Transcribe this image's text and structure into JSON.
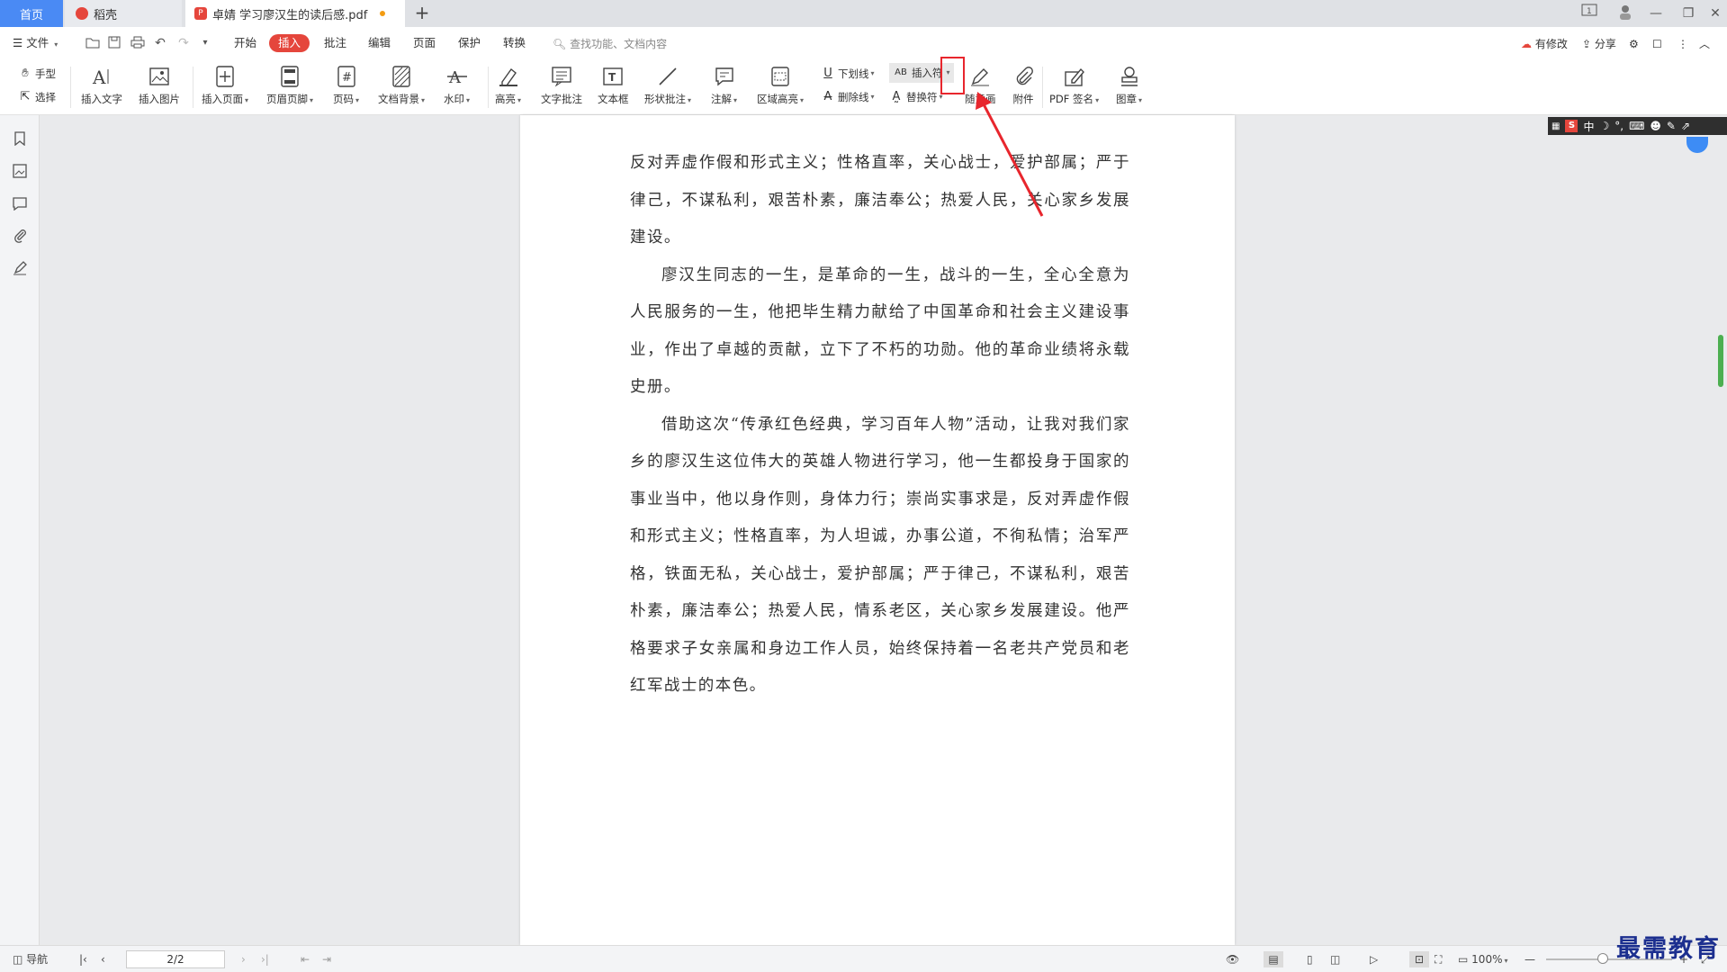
{
  "tabs": {
    "home": "首页",
    "daoke": "稻壳",
    "doc_title": "卓婧 学习廖汉生的读后感.pdf",
    "new_tab": "+"
  },
  "menu": {
    "file": "文件",
    "items": [
      "开始",
      "插入",
      "批注",
      "编辑",
      "页面",
      "保护",
      "转换"
    ],
    "active": "插入",
    "search_placeholder": "查找功能、文档内容",
    "has_changes": "有修改",
    "share": "分享"
  },
  "ribbon": {
    "hand": "手型",
    "select": "选择",
    "insert_text": "插入文字",
    "insert_image": "插入图片",
    "insert_page": "插入页面",
    "header_footer": "页眉页脚",
    "page_number": "页码",
    "doc_background": "文档背景",
    "watermark": "水印",
    "highlight": "高亮",
    "text_comment": "文字批注",
    "textbox": "文本框",
    "shape_comment": "形状批注",
    "annotation": "注解",
    "area_highlight": "区域高亮",
    "underline": "下划线",
    "strikethrough": "删除线",
    "insert_symbol": "插入符",
    "replace_symbol": "替换符",
    "freehand": "随意画",
    "attachment": "附件",
    "pdf_sign": "PDF 签名",
    "stamp": "图章"
  },
  "document": {
    "paragraphs": [
      {
        "indent": false,
        "text": "反对弄虚作假和形式主义；性格直率，关心战士，爱护部属；严于律己，不谋私利，艰苦朴素，廉洁奉公；热爱人民，关心家乡发展建设。"
      },
      {
        "indent": true,
        "text": "廖汉生同志的一生，是革命的一生，战斗的一生，全心全意为人民服务的一生，他把毕生精力献给了中国革命和社会主义建设事业，作出了卓越的贡献，立下了不朽的功勋。他的革命业绩将永载史册。"
      },
      {
        "indent": true,
        "text": "借助这次“传承红色经典，学习百年人物”活动，让我对我们家乡的廖汉生这位伟大的英雄人物进行学习，他一生都投身于国家的事业当中，他以身作则，身体力行；崇尚实事求是，反对弄虚作假和形式主义；性格直率，为人坦诚，办事公道，不徇私情；治军严格，铁面无私，关心战士，爱护部属；严于律己，不谋私利，艰苦朴素，廉洁奉公；热爱人民，情系老区，关心家乡发展建设。他严格要求子女亲属和身边工作人员，始终保持着一名老共产党员和老红军战士的本色。"
      }
    ]
  },
  "ime": {
    "label": "中"
  },
  "statusbar": {
    "nav": "导航",
    "page": "2/2",
    "zoom": "100%",
    "zoom_level": 0.45
  },
  "watermark": "最需教育",
  "colors": {
    "accent": "#e5463c",
    "tab_home": "#4a8af4",
    "annotation": "#e8262d"
  }
}
